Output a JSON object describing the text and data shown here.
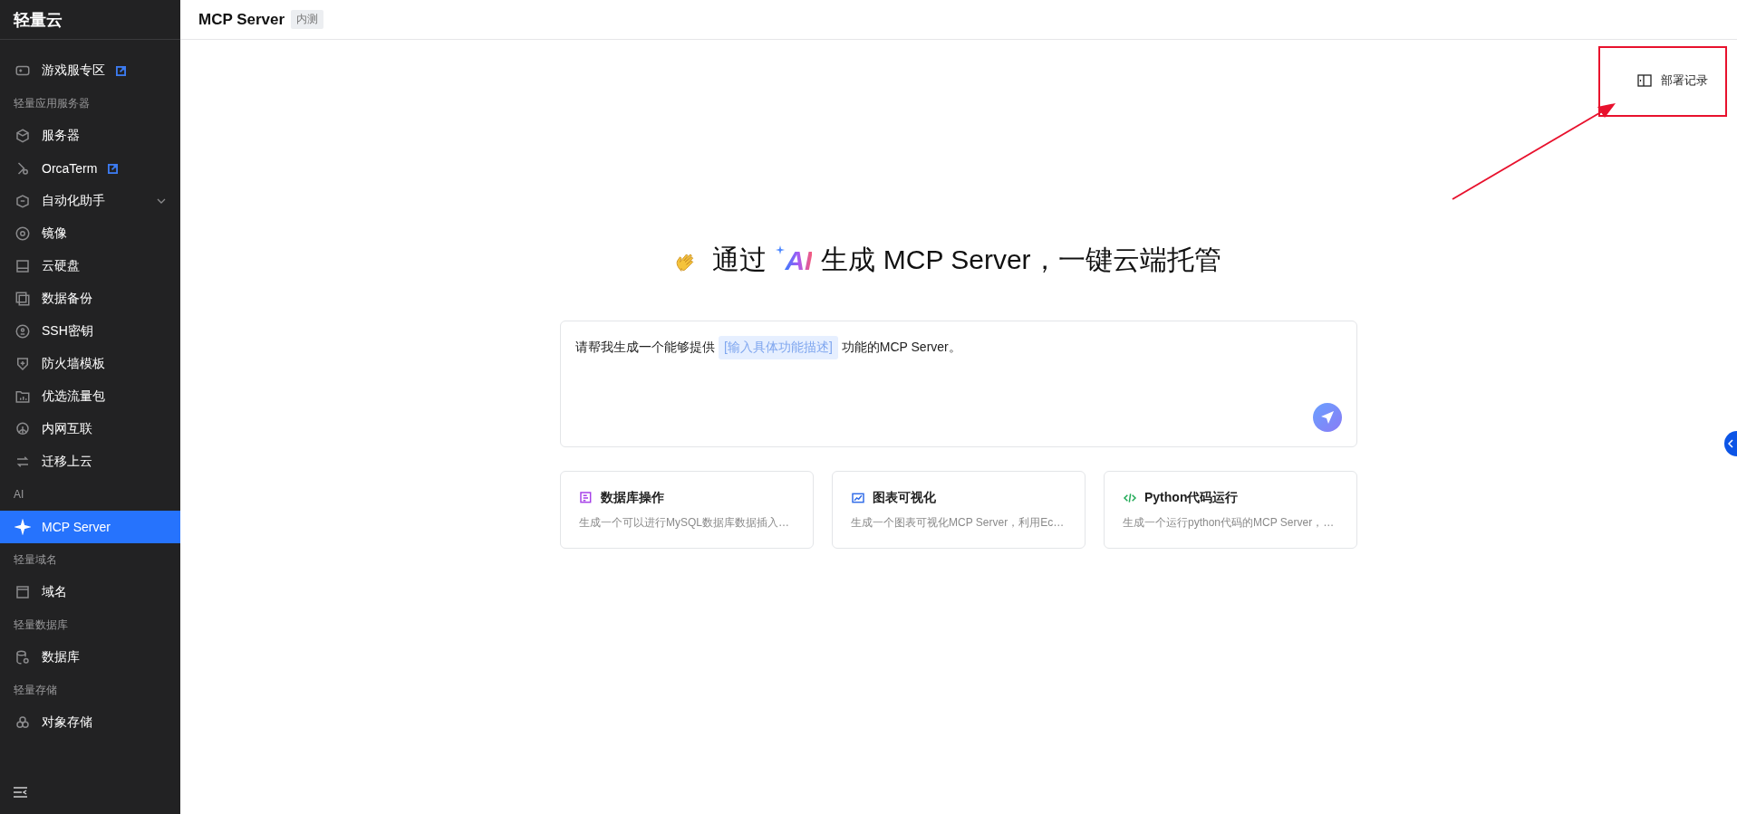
{
  "sidebar": {
    "brand": "轻量云",
    "items": [
      {
        "kind": "item",
        "label": "游戏服专区",
        "external": true,
        "expandable": false,
        "selected": false
      },
      {
        "kind": "section",
        "label": "轻量应用服务器"
      },
      {
        "kind": "item",
        "label": "服务器",
        "external": false,
        "expandable": false,
        "selected": false
      },
      {
        "kind": "item",
        "label": "OrcaTerm",
        "external": true,
        "expandable": false,
        "selected": false
      },
      {
        "kind": "item",
        "label": "自动化助手",
        "external": false,
        "expandable": true,
        "selected": false
      },
      {
        "kind": "item",
        "label": "镜像",
        "external": false,
        "expandable": false,
        "selected": false
      },
      {
        "kind": "item",
        "label": "云硬盘",
        "external": false,
        "expandable": false,
        "selected": false
      },
      {
        "kind": "item",
        "label": "数据备份",
        "external": false,
        "expandable": false,
        "selected": false
      },
      {
        "kind": "item",
        "label": "SSH密钥",
        "external": false,
        "expandable": false,
        "selected": false
      },
      {
        "kind": "item",
        "label": "防火墙模板",
        "external": false,
        "expandable": false,
        "selected": false
      },
      {
        "kind": "item",
        "label": "优选流量包",
        "external": false,
        "expandable": false,
        "selected": false
      },
      {
        "kind": "item",
        "label": "内网互联",
        "external": false,
        "expandable": false,
        "selected": false
      },
      {
        "kind": "item",
        "label": "迁移上云",
        "external": false,
        "expandable": false,
        "selected": false
      },
      {
        "kind": "section",
        "label": "AI"
      },
      {
        "kind": "item",
        "label": "MCP Server",
        "external": false,
        "expandable": false,
        "selected": true
      },
      {
        "kind": "section",
        "label": "轻量域名"
      },
      {
        "kind": "item",
        "label": "域名",
        "external": false,
        "expandable": false,
        "selected": false
      },
      {
        "kind": "section",
        "label": "轻量数据库"
      },
      {
        "kind": "item",
        "label": "数据库",
        "external": false,
        "expandable": false,
        "selected": false
      },
      {
        "kind": "section",
        "label": "轻量存储"
      },
      {
        "kind": "item",
        "label": "对象存储",
        "external": false,
        "expandable": false,
        "selected": false
      }
    ]
  },
  "header": {
    "title": "MCP Server",
    "badge": "内测"
  },
  "deploy_button": {
    "label": "部署记录"
  },
  "hero": {
    "before": "通过",
    "ai": "AI",
    "after": "生成 MCP Server，一键云端托管"
  },
  "prompt": {
    "before": "请帮我生成一个能够提供",
    "slot": "[输入具体功能描述]",
    "after": "功能的MCP Server。"
  },
  "templates": [
    {
      "title": "数据库操作",
      "description": "生成一个可以进行MySQL数据库数据插入…",
      "color": "#a640e8"
    },
    {
      "title": "图表可视化",
      "description": "生成一个图表可视化MCP Server，利用Ec…",
      "color": "#2f6be8"
    },
    {
      "title": "Python代码运行",
      "description": "生成一个运行python代码的MCP Server，…",
      "color": "#1faa55"
    }
  ]
}
